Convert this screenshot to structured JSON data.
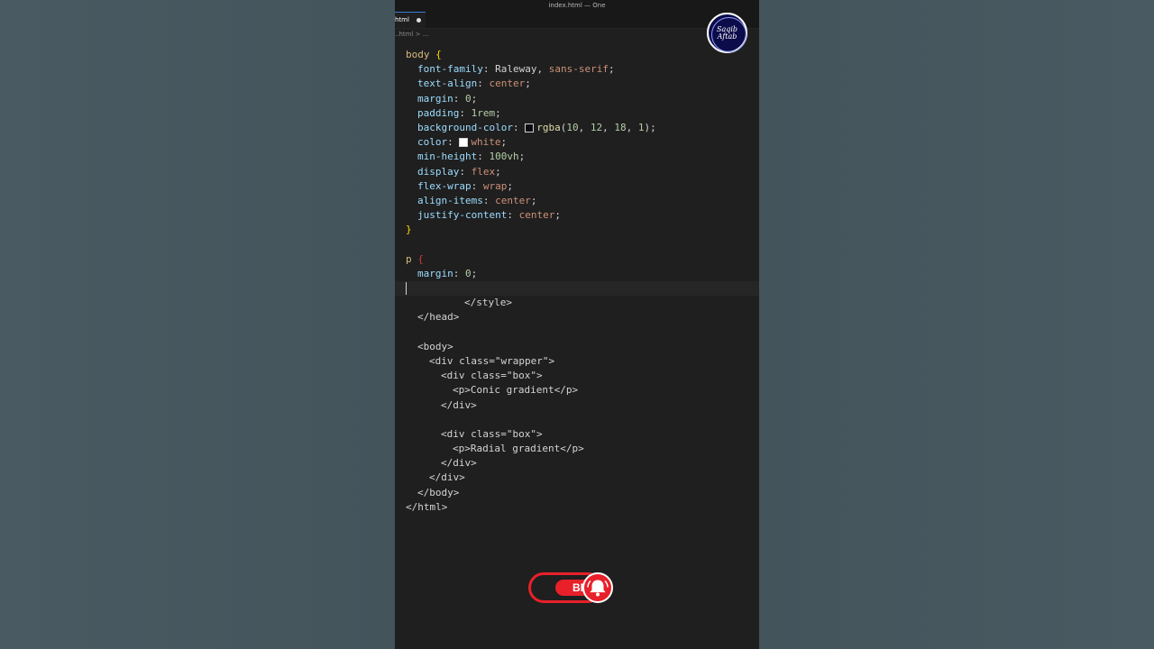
{
  "window": {
    "title": "index.html — One"
  },
  "tab": {
    "label": "html"
  },
  "breadcrumb": {
    "text": "..html > ..."
  },
  "code_lines": [
    {
      "segments": [
        {
          "t": "body ",
          "c": "sel"
        },
        {
          "t": "{",
          "c": "brace"
        }
      ]
    },
    {
      "indent": 1,
      "segments": [
        {
          "t": "font-family",
          "c": "prop"
        },
        {
          "t": ": ",
          "c": "tag"
        },
        {
          "t": "Raleway",
          "c": "tag"
        },
        {
          "t": ", ",
          "c": "tag"
        },
        {
          "t": "sans-serif",
          "c": "val"
        },
        {
          "t": ";",
          "c": "tag"
        }
      ]
    },
    {
      "indent": 1,
      "segments": [
        {
          "t": "text-align",
          "c": "prop"
        },
        {
          "t": ": ",
          "c": "tag"
        },
        {
          "t": "center",
          "c": "val"
        },
        {
          "t": ";",
          "c": "tag"
        }
      ]
    },
    {
      "indent": 1,
      "segments": [
        {
          "t": "margin",
          "c": "prop"
        },
        {
          "t": ": ",
          "c": "tag"
        },
        {
          "t": "0",
          "c": "num"
        },
        {
          "t": ";",
          "c": "tag"
        }
      ]
    },
    {
      "indent": 1,
      "segments": [
        {
          "t": "padding",
          "c": "prop"
        },
        {
          "t": ": ",
          "c": "tag"
        },
        {
          "t": "1rem",
          "c": "num"
        },
        {
          "t": ";",
          "c": "tag"
        }
      ]
    },
    {
      "indent": 1,
      "segments": [
        {
          "t": "background-color",
          "c": "prop"
        },
        {
          "t": ": ",
          "c": "tag"
        },
        {
          "swatch": "#0a0c12"
        },
        {
          "t": "rgba",
          "c": "fn"
        },
        {
          "t": "(",
          "c": "tag"
        },
        {
          "t": "10",
          "c": "num"
        },
        {
          "t": ", ",
          "c": "tag"
        },
        {
          "t": "12",
          "c": "num"
        },
        {
          "t": ", ",
          "c": "tag"
        },
        {
          "t": "18",
          "c": "num"
        },
        {
          "t": ", ",
          "c": "tag"
        },
        {
          "t": "1",
          "c": "num"
        },
        {
          "t": ");",
          "c": "tag"
        }
      ]
    },
    {
      "indent": 1,
      "segments": [
        {
          "t": "color",
          "c": "prop"
        },
        {
          "t": ": ",
          "c": "tag"
        },
        {
          "swatch": "#ffffff"
        },
        {
          "t": "white",
          "c": "val"
        },
        {
          "t": ";",
          "c": "tag"
        }
      ]
    },
    {
      "indent": 1,
      "segments": [
        {
          "t": "min-height",
          "c": "prop"
        },
        {
          "t": ": ",
          "c": "tag"
        },
        {
          "t": "100vh",
          "c": "num"
        },
        {
          "t": ";",
          "c": "tag"
        }
      ]
    },
    {
      "indent": 1,
      "segments": [
        {
          "t": "display",
          "c": "prop"
        },
        {
          "t": ": ",
          "c": "tag"
        },
        {
          "t": "flex",
          "c": "val"
        },
        {
          "t": ";",
          "c": "tag"
        }
      ]
    },
    {
      "indent": 1,
      "segments": [
        {
          "t": "flex-wrap",
          "c": "prop"
        },
        {
          "t": ": ",
          "c": "tag"
        },
        {
          "t": "wrap",
          "c": "val"
        },
        {
          "t": ";",
          "c": "tag"
        }
      ]
    },
    {
      "indent": 1,
      "segments": [
        {
          "t": "align-items",
          "c": "prop"
        },
        {
          "t": ": ",
          "c": "tag"
        },
        {
          "t": "center",
          "c": "val"
        },
        {
          "t": ";",
          "c": "tag"
        }
      ]
    },
    {
      "indent": 1,
      "segments": [
        {
          "t": "justify-content",
          "c": "prop"
        },
        {
          "t": ": ",
          "c": "tag"
        },
        {
          "t": "center",
          "c": "val"
        },
        {
          "t": ";",
          "c": "tag"
        }
      ]
    },
    {
      "segments": [
        {
          "t": "}",
          "c": "brace"
        }
      ]
    },
    {
      "segments": []
    },
    {
      "segments": [
        {
          "t": "p ",
          "c": "sel"
        },
        {
          "t": "{",
          "c": "brace-red"
        }
      ]
    },
    {
      "indent": 1,
      "segments": [
        {
          "t": "margin",
          "c": "prop"
        },
        {
          "t": ": ",
          "c": "tag"
        },
        {
          "t": "0",
          "c": "num"
        },
        {
          "t": ";",
          "c": "tag"
        }
      ]
    },
    {
      "current": true,
      "segments": []
    },
    {
      "indent": 5,
      "segments": [
        {
          "t": "</style>",
          "c": "tag"
        }
      ]
    },
    {
      "indent": 1,
      "segments": [
        {
          "t": "</head>",
          "c": "tag"
        }
      ]
    },
    {
      "segments": []
    },
    {
      "indent": 1,
      "segments": [
        {
          "t": "<body>",
          "c": "tag"
        }
      ]
    },
    {
      "indent": 2,
      "segments": [
        {
          "t": "<div ",
          "c": "tag"
        },
        {
          "t": "class",
          "c": "tag"
        },
        {
          "t": "=\"wrapper\">",
          "c": "tag"
        }
      ]
    },
    {
      "indent": 3,
      "segments": [
        {
          "t": "<div ",
          "c": "tag"
        },
        {
          "t": "class",
          "c": "tag"
        },
        {
          "t": "=\"box\">",
          "c": "tag"
        }
      ]
    },
    {
      "indent": 4,
      "segments": [
        {
          "t": "<p>",
          "c": "tag"
        },
        {
          "t": "Conic gradient",
          "c": "tag"
        },
        {
          "t": "</p>",
          "c": "tag"
        }
      ]
    },
    {
      "indent": 3,
      "segments": [
        {
          "t": "</div>",
          "c": "tag"
        }
      ]
    },
    {
      "segments": []
    },
    {
      "indent": 3,
      "segments": [
        {
          "t": "<div ",
          "c": "tag"
        },
        {
          "t": "class",
          "c": "tag"
        },
        {
          "t": "=\"box\">",
          "c": "tag"
        }
      ]
    },
    {
      "indent": 4,
      "segments": [
        {
          "t": "<p>",
          "c": "tag"
        },
        {
          "t": "Radial gradient",
          "c": "tag"
        },
        {
          "t": "</p>",
          "c": "tag"
        }
      ]
    },
    {
      "indent": 3,
      "segments": [
        {
          "t": "</div>",
          "c": "tag"
        }
      ]
    },
    {
      "indent": 2,
      "segments": [
        {
          "t": "</div>",
          "c": "tag"
        }
      ]
    },
    {
      "indent": 1,
      "segments": [
        {
          "t": "</body>",
          "c": "tag"
        }
      ]
    },
    {
      "segments": [
        {
          "t": "</html>",
          "c": "tag"
        }
      ]
    }
  ],
  "avatar": {
    "line1": "Saqib",
    "line2": "Aftab"
  },
  "subscribe": {
    "label": "BE",
    "icon": "bell-icon",
    "accent": "#e8202a"
  },
  "colors": {
    "editor_bg": "#1f1f1f",
    "side_bg": "#485860"
  }
}
